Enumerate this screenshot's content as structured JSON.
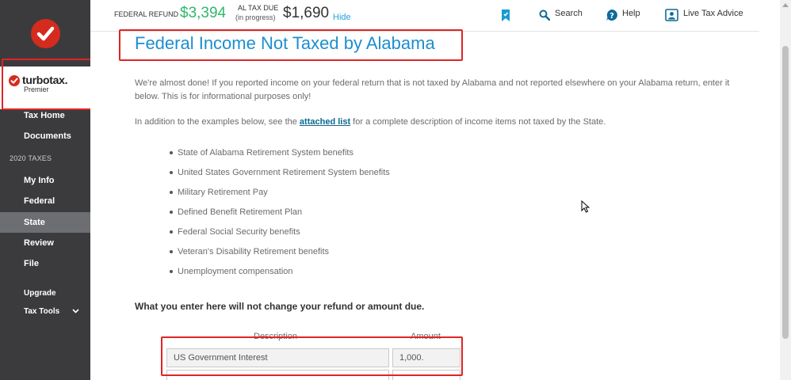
{
  "sidebar": {
    "brand_name": "turbotax.",
    "brand_edition": "Premier",
    "items": [
      {
        "label": "Tax Home"
      },
      {
        "label": "Documents"
      },
      {
        "label": "My Info"
      },
      {
        "label": "Federal"
      },
      {
        "label": "State"
      },
      {
        "label": "Review"
      },
      {
        "label": "File"
      },
      {
        "label": "Upgrade"
      },
      {
        "label": "Tax Tools"
      }
    ],
    "section_label": "2020 TAXES",
    "active_item": "State"
  },
  "header": {
    "federal_refund_label": "FEDERAL REFUND",
    "federal_refund_value": "$3,394",
    "al_tax_label": "AL TAX DUE",
    "al_tax_sub": "(in progress)",
    "al_tax_value": "$1,690",
    "hide_label": "Hide",
    "search_label": "Search",
    "help_label": "Help",
    "live_label": "Live Tax Advice"
  },
  "main": {
    "title": "Federal Income Not Taxed by Alabama",
    "intro": "We're almost done! If you reported income on your federal return that is not taxed by Alabama and not reported elsewhere on your Alabama return, enter it below. This is for informational purposes only!",
    "addition_prefix": "In addition to the examples below, see the",
    "addition_link": "attached list",
    "addition_suffix": "for a complete description of income items not taxed by the State.",
    "bullets": [
      "State of Alabama Retirement System benefits",
      "United States Government Retirement System benefits",
      "Military Retirement Pay",
      "Defined Benefit Retirement Plan",
      "Federal Social Security benefits",
      "Veteran's Disability Retirement benefits",
      "Unemployment compensation"
    ],
    "note": "What you enter here will not change your refund or amount due.",
    "table": {
      "headers": [
        "Description",
        "Amount"
      ],
      "rows": [
        {
          "description": "US Government Interest",
          "amount": "1,000."
        }
      ]
    }
  },
  "colors": {
    "accent_blue": "#1d8ecf",
    "refund_green": "#2fb86c",
    "highlight_red": "#e02424",
    "sidebar_bg": "#3b3b3d"
  }
}
